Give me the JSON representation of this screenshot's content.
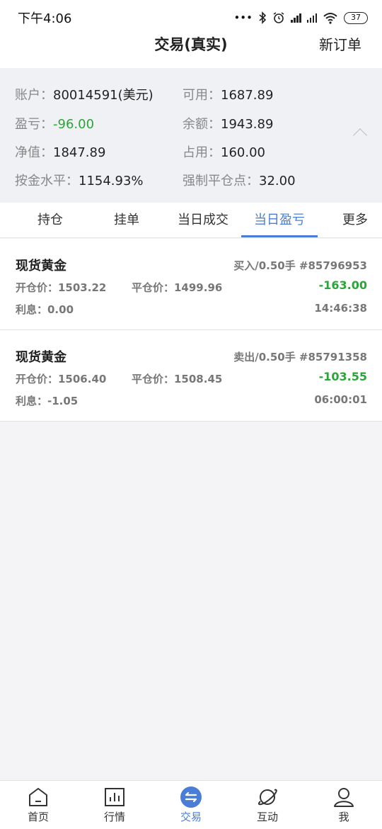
{
  "status_bar": {
    "time": "下午4:06",
    "battery": "37"
  },
  "header": {
    "title": "交易(真实)",
    "action": "新订单"
  },
  "account": {
    "account_label": "账户：",
    "account_value": "80014591(美元)",
    "available_label": "可用：",
    "available_value": "1687.89",
    "pl_label": "盈亏：",
    "pl_value": "-96.00",
    "balance_label": "余额：",
    "balance_value": "1943.89",
    "equity_label": "净值：",
    "equity_value": "1847.89",
    "margin_label": "占用：",
    "margin_value": "160.00",
    "margin_level_label": "按金水平：",
    "margin_level_value": "1154.93%",
    "stop_out_label": "强制平仓点：",
    "stop_out_value": "32.00"
  },
  "tabs": [
    {
      "label": "持仓"
    },
    {
      "label": "挂单"
    },
    {
      "label": "当日成交"
    },
    {
      "label": "当日盈亏"
    },
    {
      "label": "更多"
    }
  ],
  "orders": [
    {
      "name": "现货黄金",
      "side": "买入/0.50手  #85796953",
      "open_price": "开仓价：1503.22",
      "close_price": "平仓价：1499.96",
      "profit": "-163.00",
      "interest": "利息：0.00",
      "time": "14:46:38"
    },
    {
      "name": "现货黄金",
      "side": "卖出/0.50手  #85791358",
      "open_price": "开仓价：1506.40",
      "close_price": "平仓价：1508.45",
      "profit": "-103.55",
      "interest": "利息：-1.05",
      "time": "06:00:01"
    }
  ],
  "bottom_nav": [
    {
      "label": "首页",
      "icon": "home-icon"
    },
    {
      "label": "行情",
      "icon": "chart-icon"
    },
    {
      "label": "交易",
      "icon": "trade-icon"
    },
    {
      "label": "互动",
      "icon": "planet-icon"
    },
    {
      "label": "我",
      "icon": "user-icon"
    }
  ],
  "colors": {
    "accent": "#4a7ed6",
    "loss_green": "#2aa537"
  }
}
